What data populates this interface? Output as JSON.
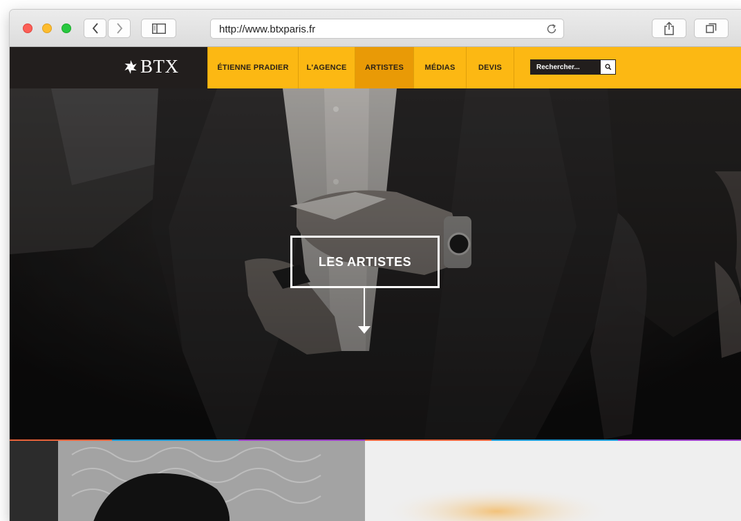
{
  "browser": {
    "url": "http://www.btxparis.fr"
  },
  "site": {
    "logo_text": "BTX",
    "nav": [
      {
        "label": "ÉTIENNE PRADIER",
        "active": false
      },
      {
        "label": "L'AGENCE",
        "active": false
      },
      {
        "label": "ARTISTES",
        "active": true
      },
      {
        "label": "MÉDIAS",
        "active": false
      },
      {
        "label": "DEVIS",
        "active": false
      }
    ],
    "search_placeholder": "Rechercher...",
    "colors": {
      "nav_background": "#fcb813",
      "nav_active": "#e99a06",
      "logo_background": "#221e1d"
    }
  },
  "hero": {
    "title": "LES ARTISTES",
    "image": "magician-holding-cards-photo"
  },
  "band_colors": [
    "#e8623a",
    "#1a9ad6",
    "#9a3fc6",
    "#e8623a",
    "#1a9ad6",
    "#9a3fc6"
  ],
  "panels": {
    "left_image": "artist-portrait-photo",
    "right_image": "light-background-photo"
  }
}
